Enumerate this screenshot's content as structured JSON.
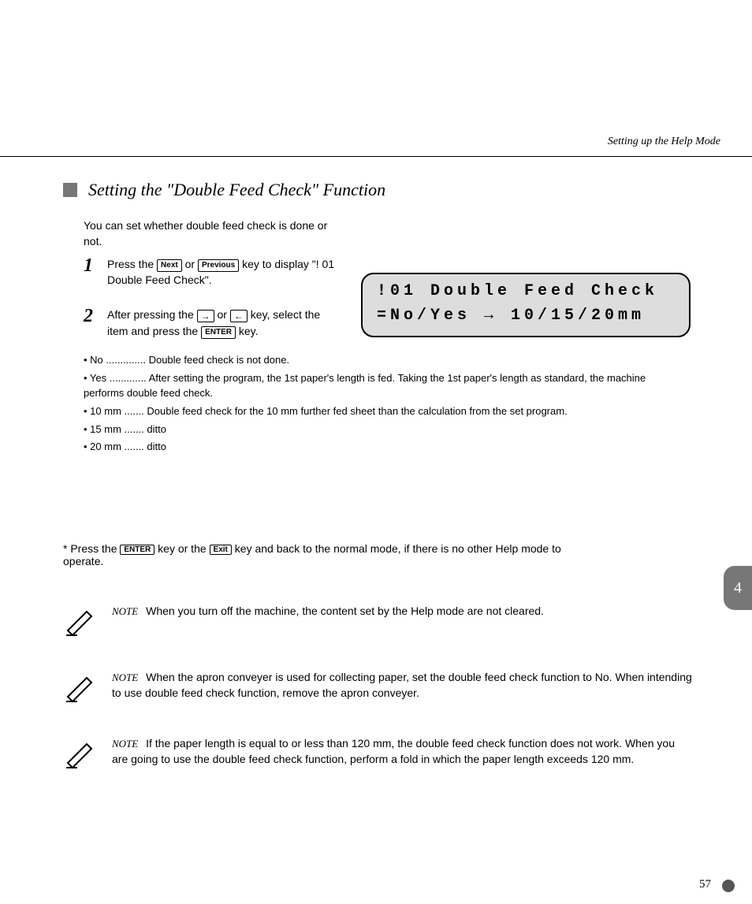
{
  "header": {
    "running_title": "Setting up the Help Mode"
  },
  "section": {
    "title": "Setting the \"Double Feed Check\" Function"
  },
  "intro": "You can set whether double feed check is done or not.",
  "steps": {
    "s1": {
      "num": "1",
      "pre": "Press the ",
      "key1": "Next",
      "mid": " or ",
      "key2": "Previous",
      "post": " key to display \"! 01 Double Feed Check\"."
    },
    "s2": {
      "num": "2",
      "pre": "After pressing the ",
      "mid": " or ",
      "post1": " key, select the item and press the ",
      "key_enter": "ENTER",
      "post2": " key."
    }
  },
  "opts": {
    "no": "• No .............. Double feed check is not done.",
    "yes": "• Yes ............. After setting the program, the 1st paper's length is fed. Taking the 1st paper's length as standard, the machine performs double feed check.",
    "v10": "• 10 mm ....... Double feed check for the 10 mm further fed sheet than the calculation from the set program.",
    "v15": "• 15 mm ....... ditto",
    "v20": "• 20 mm ....... ditto"
  },
  "press_enter": {
    "pre": "* Press the ",
    "k1": "ENTER",
    "mid": " key or the ",
    "k2": "Exit",
    "post": " key and back to the normal mode, if there is no other Help mode to operate."
  },
  "lcd": {
    "line1": "!01 Double Feed Check",
    "line2": "=No/Yes → 10/15/20mm"
  },
  "notes": {
    "label": "NOTE",
    "n1": "When you turn off the machine, the content set by the Help mode are not cleared.",
    "n2": "When the apron conveyer is used for collecting paper, set the double feed check function to No. When intending to use double feed check function, remove the apron conveyer.",
    "n3": "If the paper length is equal to or less than 120 mm, the double feed check function does not work. When you are going to use the double feed check function, perform a fold in which the paper length exceeds 120 mm."
  },
  "sidetab": "4",
  "page": "57"
}
